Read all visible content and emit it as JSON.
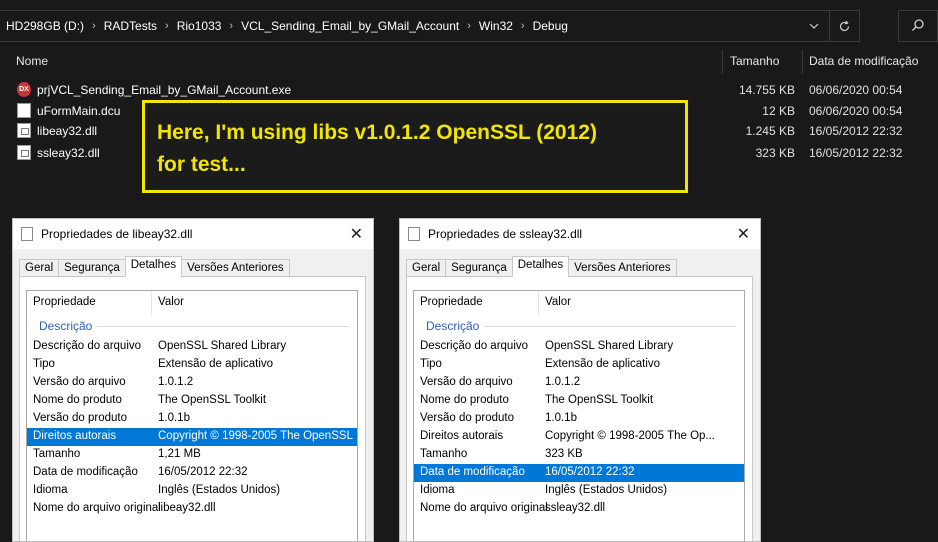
{
  "address": {
    "crumbs": [
      "HD298GB (D:)",
      "RADTests",
      "Rio1033",
      "VCL_Sending_Email_by_GMail_Account",
      "Win32",
      "Debug"
    ]
  },
  "columns": {
    "name": "Nome",
    "size": "Tamanho",
    "modified": "Data de modificação"
  },
  "files": [
    {
      "name": "prjVCL_Sending_Email_by_GMail_Account.exe",
      "size": "14.755 KB",
      "modified": "06/06/2020 00:54",
      "icon": "delphi-exe-icon"
    },
    {
      "name": "uFormMain.dcu",
      "size": "12 KB",
      "modified": "06/06/2020 00:54",
      "icon": "file-icon"
    },
    {
      "name": "libeay32.dll",
      "size": "1.245 KB",
      "modified": "16/05/2012 22:32",
      "icon": "dll-icon"
    },
    {
      "name": "ssleay32.dll",
      "size": "323 KB",
      "modified": "16/05/2012 22:32",
      "icon": "dll-icon"
    }
  ],
  "annotation": {
    "line1": "Here, I'm using libs v1.0.1.2 OpenSSL (2012)",
    "line2": "for test...",
    "color": "#f2e600"
  },
  "dialogs": [
    {
      "title": "Propriedades de libeay32.dll",
      "tabs": [
        "Geral",
        "Segurança",
        "Detalhes",
        "Versões Anteriores"
      ],
      "active_tab": "Detalhes",
      "header": {
        "property": "Propriedade",
        "value": "Valor"
      },
      "group": "Descrição",
      "rows": [
        {
          "k": "Descrição do arquivo",
          "v": "OpenSSL Shared Library"
        },
        {
          "k": "Tipo",
          "v": "Extensão de aplicativo"
        },
        {
          "k": "Versão do arquivo",
          "v": "1.0.1.2"
        },
        {
          "k": "Nome do produto",
          "v": "The OpenSSL Toolkit"
        },
        {
          "k": "Versão do produto",
          "v": "1.0.1b"
        },
        {
          "k": "Direitos autorais",
          "v": "Copyright © 1998-2005 The OpenSSL"
        },
        {
          "k": "Tamanho",
          "v": "1,21 MB"
        },
        {
          "k": "Data de modificação",
          "v": "16/05/2012 22:32"
        },
        {
          "k": "Idioma",
          "v": "Inglês (Estados Unidos)"
        },
        {
          "k": "Nome do arquivo original",
          "v": "libeay32.dll"
        }
      ],
      "selected_row": 5
    },
    {
      "title": "Propriedades de ssleay32.dll",
      "tabs": [
        "Geral",
        "Segurança",
        "Detalhes",
        "Versões Anteriores"
      ],
      "active_tab": "Detalhes",
      "header": {
        "property": "Propriedade",
        "value": "Valor"
      },
      "group": "Descrição",
      "rows": [
        {
          "k": "Descrição do arquivo",
          "v": "OpenSSL Shared Library"
        },
        {
          "k": "Tipo",
          "v": "Extensão de aplicativo"
        },
        {
          "k": "Versão do arquivo",
          "v": "1.0.1.2"
        },
        {
          "k": "Nome do produto",
          "v": "The OpenSSL Toolkit"
        },
        {
          "k": "Versão do produto",
          "v": "1.0.1b"
        },
        {
          "k": "Direitos autorais",
          "v": "Copyright © 1998-2005 The Op..."
        },
        {
          "k": "Tamanho",
          "v": "323 KB"
        },
        {
          "k": "Data de modificação",
          "v": "16/05/2012 22:32"
        },
        {
          "k": "Idioma",
          "v": "Inglês (Estados Unidos)"
        },
        {
          "k": "Nome do arquivo original",
          "v": "ssleay32.dll"
        }
      ],
      "selected_row": 7
    }
  ]
}
